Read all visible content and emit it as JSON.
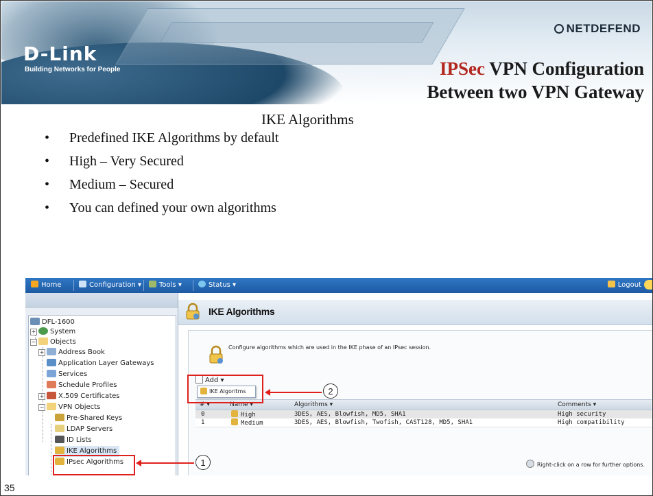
{
  "banner": {
    "brand_dlink": "D-Link",
    "brand_tagline": "Building Networks for People",
    "brand_netdefend": "NETDEFEND"
  },
  "slide": {
    "title_accent": "IPSec",
    "title_rest": " VPN Configuration",
    "title_line2": "Between two VPN Gateway",
    "subtitle": "IKE Algorithms",
    "bullets": [
      "Predefined IKE Algorithms by default",
      "High – Very Secured",
      "Medium – Secured",
      "You can defined your own algorithms"
    ],
    "page_number": "35"
  },
  "ui": {
    "topbar": {
      "home": "Home",
      "configuration": "Configuration ▾",
      "tools": "Tools ▾",
      "status": "Status ▾",
      "logout": "Logout"
    },
    "tree": {
      "device": "DFL-1600",
      "system": "System",
      "objects": "Objects",
      "address_book": "Address Book",
      "alg": "Application Layer Gateways",
      "services": "Services",
      "schedule_profiles": "Schedule Profiles",
      "certificates": "X.509 Certificates",
      "vpn_objects": "VPN Objects",
      "psk": "Pre-Shared Keys",
      "ldap": "LDAP Servers",
      "id_lists": "ID Lists",
      "ike_algorithms": "IKE Algorithms",
      "ipsec_algorithms": "IPsec Algorithms"
    },
    "page": {
      "title": "IKE Algorithms",
      "description": "Configure algorithms which are used in the IKE phase of an IPsec session.",
      "add_label": "Add ▾",
      "add_menu_item": "IKE Algoritms",
      "columns": {
        "num": "# ▾",
        "name": "Name ▾",
        "algorithms": "Algorithms ▾",
        "comments": "Comments ▾"
      },
      "rows": [
        {
          "num": "0",
          "name": "High",
          "algorithms": "3DES, AES, Blowfish, MD5, SHA1",
          "comments": "High security"
        },
        {
          "num": "1",
          "name": "Medium",
          "algorithms": "3DES, AES, Blowfish, Twofish, CAST128, MD5, SHA1",
          "comments": "High compatibility"
        }
      ],
      "hint": "Right-click on a row for further options."
    },
    "callouts": {
      "one": "1",
      "two": "2"
    }
  },
  "colors": {
    "accent_red": "#b3261e",
    "annotation_red": "#e0201c",
    "topbar_blue": "#1e5aa3"
  }
}
